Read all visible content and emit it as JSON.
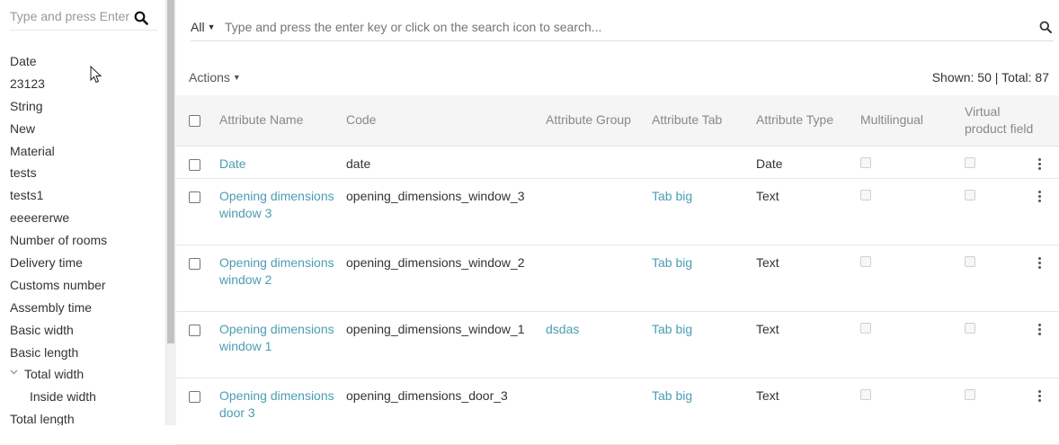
{
  "sidebar": {
    "search_placeholder": "Type and press Enter",
    "items": [
      {
        "label": "Date"
      },
      {
        "label": "23123"
      },
      {
        "label": "String"
      },
      {
        "label": "New"
      },
      {
        "label": "Material"
      },
      {
        "label": "tests"
      },
      {
        "label": "tests1"
      },
      {
        "label": "eeeererwe"
      },
      {
        "label": "Number of rooms"
      },
      {
        "label": "Delivery time"
      },
      {
        "label": "Customs number"
      },
      {
        "label": "Assembly time"
      },
      {
        "label": "Basic width"
      },
      {
        "label": "Basic length"
      },
      {
        "label": "Total width",
        "expanded": true
      },
      {
        "label": "Inside width",
        "child": true
      },
      {
        "label": "Total length"
      }
    ]
  },
  "search": {
    "filter_label": "All",
    "placeholder": "Type and press the enter key or click on the search icon to search..."
  },
  "toolbar": {
    "actions_label": "Actions",
    "shown_label": "Shown: 50",
    "separator": "|",
    "total_label": "Total: 87"
  },
  "table": {
    "headers": {
      "name": "Attribute Name",
      "code": "Code",
      "group": "Attribute Group",
      "tab": "Attribute Tab",
      "type": "Attribute Type",
      "multilingual": "Multilingual",
      "virtual": "Virtual product field"
    },
    "rows": [
      {
        "name": "Date",
        "code": "date",
        "group": "",
        "tab": "",
        "type": "Date"
      },
      {
        "name": "Opening dimensions window 3",
        "code": "opening_dimensions_window_3",
        "group": "",
        "tab": "Tab big",
        "type": "Text"
      },
      {
        "name": "Opening dimensions window 2",
        "code": "opening_dimensions_window_2",
        "group": "",
        "tab": "Tab big",
        "type": "Text"
      },
      {
        "name": "Opening dimensions window 1",
        "code": "opening_dimensions_window_1",
        "group": "dsdas",
        "tab": "Tab big",
        "type": "Text"
      },
      {
        "name": "Opening dimensions door 3",
        "code": "opening_dimensions_door_3",
        "group": "",
        "tab": "Tab big",
        "type": "Text"
      }
    ]
  },
  "colors": {
    "link": "#4b9db3",
    "header_bg": "#f5f5f5"
  }
}
